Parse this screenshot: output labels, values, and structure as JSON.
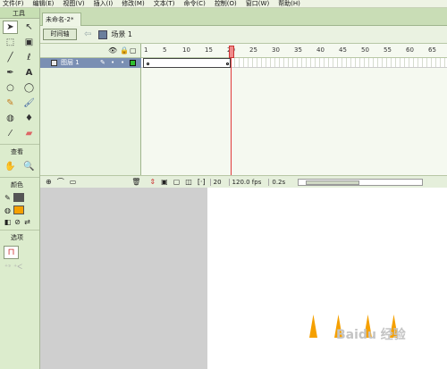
{
  "menu": [
    "文件(F)",
    "编辑(E)",
    "视图(V)",
    "插入(I)",
    "修改(M)",
    "文本(T)",
    "命令(C)",
    "控制(O)",
    "窗口(W)",
    "帮助(H)"
  ],
  "tools_panel": {
    "header": "工具",
    "view_label": "查看",
    "color_label": "颜色",
    "options_label": "选项",
    "stroke_color": "#555555",
    "fill_color": "#22cc22"
  },
  "document": {
    "tab_title": "未命名-2*"
  },
  "editbar": {
    "timeline_button": "时间轴",
    "scene_label": "场景 1"
  },
  "timeline": {
    "layer_name": "图层 1",
    "ruler_ticks": [
      "1",
      "5",
      "10",
      "15",
      "20",
      "25",
      "30",
      "35",
      "40",
      "45",
      "50",
      "55",
      "60",
      "65"
    ],
    "current_frame": "20",
    "fps": "120.0 fps",
    "elapsed": "0.2s"
  },
  "stage": {
    "shape_color": "#f5a000",
    "watermark": "Baidu 经验"
  }
}
